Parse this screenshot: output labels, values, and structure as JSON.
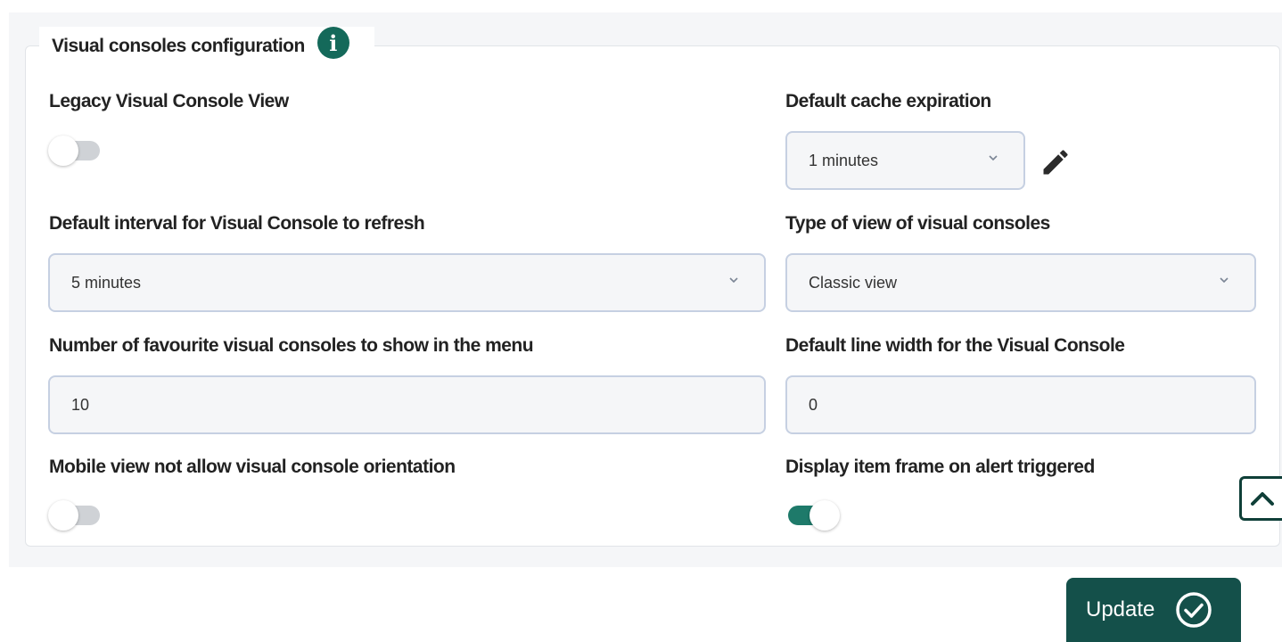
{
  "section": {
    "title": "Visual consoles configuration",
    "info_icon": "info-icon"
  },
  "fields": {
    "legacy_view": {
      "label": "Legacy Visual Console View",
      "enabled": false
    },
    "cache_expiration": {
      "label": "Default cache expiration",
      "value": "1 minutes",
      "edit_icon": "pencil-icon"
    },
    "refresh_interval": {
      "label": "Default interval for Visual Console to refresh",
      "value": "5 minutes"
    },
    "view_type": {
      "label": "Type of view of visual consoles",
      "value": "Classic view"
    },
    "favourites": {
      "label": "Number of favourite visual consoles to show in the menu",
      "value": "10"
    },
    "line_width": {
      "label": "Default line width for the Visual Console",
      "value": "0"
    },
    "mobile_orientation": {
      "label": "Mobile view not allow visual console orientation",
      "enabled": false
    },
    "item_frame": {
      "label": "Display item frame on alert triggered",
      "enabled": true
    }
  },
  "actions": {
    "update_label": "Update",
    "update_icon": "check-circle-icon",
    "scroll_top_icon": "chevron-up-icon"
  },
  "colors": {
    "accent": "#14504a",
    "toggle_on": "#1e7a6a",
    "info": "#14695a"
  }
}
